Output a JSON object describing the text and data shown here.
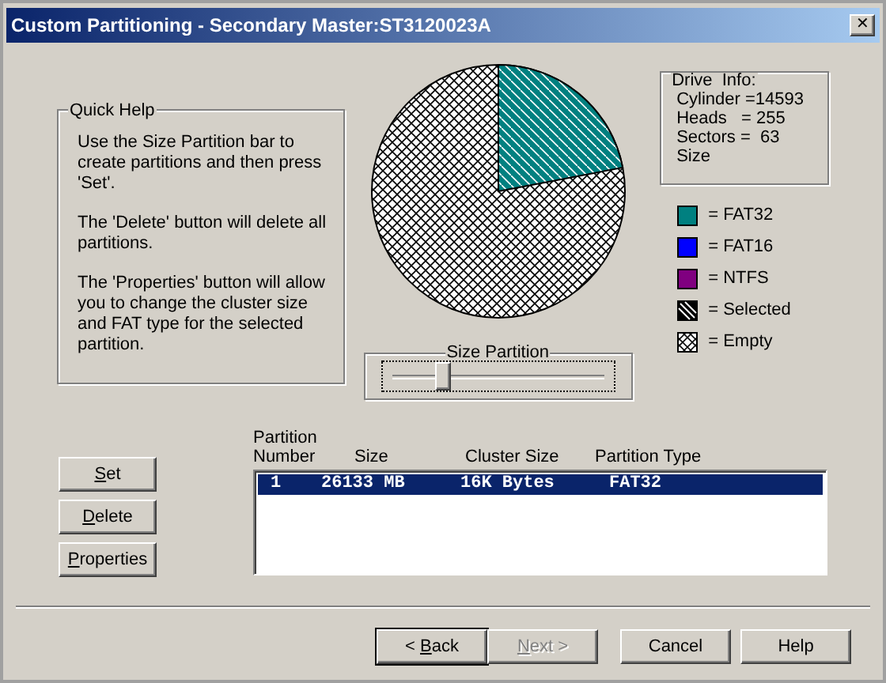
{
  "window": {
    "title": "Custom Partitioning - Secondary Master:ST3120023A",
    "close": "✕"
  },
  "quick_help": {
    "title": "Quick Help",
    "paragraphs": [
      "Use the Size Partition bar to create partitions and then press 'Set'.",
      "The 'Delete' button will delete all partitions.",
      "The 'Properties' button will allow you to change the cluster size and FAT type for the selected partition."
    ]
  },
  "drive_info": {
    "title": "Drive  Info:",
    "lines": [
      "Cylinder =14593",
      "Heads   = 255",
      "Sectors =  63",
      "Size"
    ]
  },
  "legend": [
    {
      "kind": "solid",
      "color": "#008080",
      "label": "= FAT32"
    },
    {
      "kind": "solid",
      "color": "#0000ff",
      "label": "= FAT16"
    },
    {
      "kind": "solid",
      "color": "#800080",
      "label": "= NTFS"
    },
    {
      "kind": "hatched",
      "label": "= Selected"
    },
    {
      "kind": "crosshatch",
      "label": "= Empty"
    }
  ],
  "size_partition": {
    "title": "Size Partition",
    "level": 0.22
  },
  "side_buttons": [
    {
      "key": "S",
      "after": "et"
    },
    {
      "key": "D",
      "after": "elete"
    },
    {
      "key": "P",
      "after": "roperties"
    }
  ],
  "table": {
    "columns": [
      "Partition Number",
      "Size",
      "Cluster Size",
      "Partition Type"
    ],
    "rows": [
      {
        "cells": [
          "1",
          "26133 MB",
          "16K Bytes",
          "FAT32"
        ],
        "selected": true
      }
    ]
  },
  "footer_buttons": [
    {
      "before": "< ",
      "key": "B",
      "after": "ack",
      "disabled": false
    },
    {
      "key": "N",
      "after": "ext >",
      "disabled": true
    },
    {
      "before": "Cancel",
      "disabled": false
    },
    {
      "before": "Help",
      "disabled": false
    }
  ]
}
